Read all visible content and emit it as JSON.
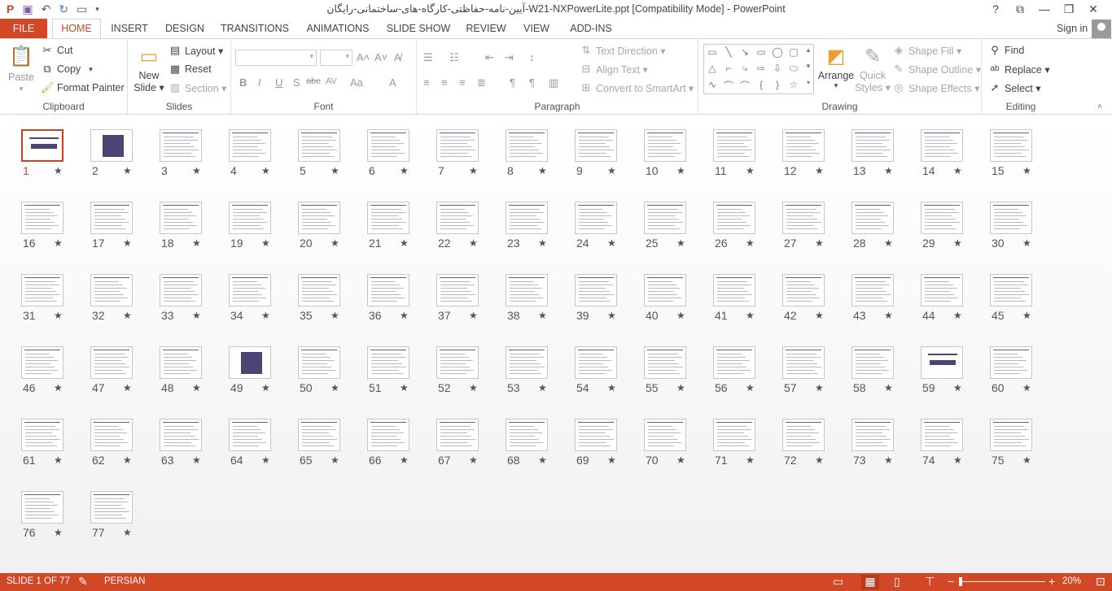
{
  "titlebar": {
    "title": "آیین-نامه-حفاظتی-کارگاه-های-ساختمانی-رایگان-W21-NXPowerLite.ppt [Compatibility Mode] - PowerPoint",
    "qat_icons": [
      "powerpoint-logo-icon",
      "save-icon",
      "undo-icon",
      "redo-icon",
      "start-from-beginning-icon",
      "customize-qat-icon"
    ],
    "window_buttons": [
      "?",
      "⧉",
      "—",
      "❐",
      "✕"
    ]
  },
  "tabs": {
    "file": "FILE",
    "items": [
      "HOME",
      "INSERT",
      "DESIGN",
      "TRANSITIONS",
      "ANIMATIONS",
      "SLIDE SHOW",
      "REVIEW",
      "VIEW",
      "ADD-INS"
    ],
    "active": "HOME",
    "signin": "Sign in"
  },
  "ribbon": {
    "clipboard": {
      "label": "Clipboard",
      "paste": "Paste",
      "cut": "Cut",
      "copy": "Copy",
      "format_painter": "Format Painter"
    },
    "slides": {
      "label": "Slides",
      "new_slide_1": "New",
      "new_slide_2": "Slide ▾",
      "layout": "Layout ▾",
      "reset": "Reset",
      "section": "Section ▾"
    },
    "font": {
      "label": "Font"
    },
    "paragraph": {
      "label": "Paragraph",
      "text_direction": "Text Direction ▾",
      "align_text": "Align Text ▾",
      "convert_smartart": "Convert to SmartArt ▾"
    },
    "drawing": {
      "label": "Drawing",
      "arrange": "Arrange",
      "quick_styles_1": "Quick",
      "quick_styles_2": "Styles ▾",
      "shape_fill": "Shape Fill ▾",
      "shape_outline": "Shape Outline ▾",
      "shape_effects": "Shape Effects ▾"
    },
    "editing": {
      "label": "Editing",
      "find": "Find",
      "replace": "Replace ▾",
      "select": "Select ▾"
    }
  },
  "sorter": {
    "slide_count": 77,
    "selected": 1,
    "star": "★",
    "dark_slides": [
      2,
      49
    ],
    "title_slides": [
      1,
      59
    ]
  },
  "status": {
    "slide_info": "SLIDE 1 OF 77",
    "language": "PERSIAN",
    "zoom": "20%",
    "zoom_minus": "−",
    "zoom_plus": "+"
  },
  "colors": {
    "accent": "#d24726",
    "selection": "#c8431e",
    "slide_dark": "#4b4474"
  }
}
